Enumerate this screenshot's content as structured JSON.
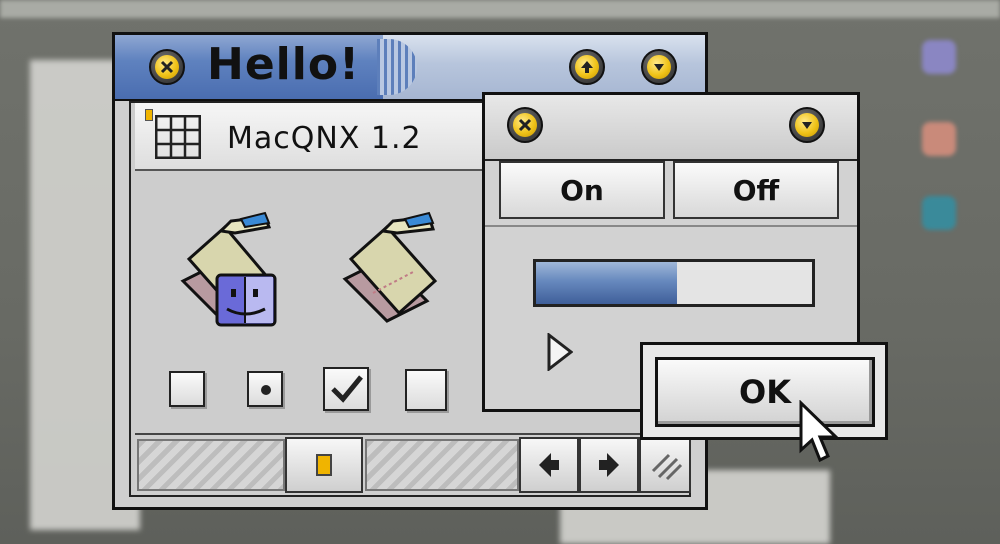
{
  "main_window": {
    "title": "Hello!",
    "close_icon": "close-icon",
    "collapse_icon": "arrow-up-icon",
    "expand_icon": "arrow-down-icon",
    "accent_color": "#f0c318"
  },
  "inner_window": {
    "title": "MacQNX 1.2",
    "icons": [
      "finder-folder-icon",
      "folder-icon"
    ],
    "checkboxes": [
      {
        "type": "checkbox",
        "checked": false
      },
      {
        "type": "radio",
        "checked": true
      },
      {
        "type": "checkbox",
        "checked": true
      },
      {
        "type": "checkbox",
        "checked": false
      }
    ]
  },
  "switch_window": {
    "on_label": "On",
    "off_label": "Off",
    "progress_fraction": 0.51,
    "progress_color": "#6789be"
  },
  "ok_dialog": {
    "ok_label": "OK"
  }
}
